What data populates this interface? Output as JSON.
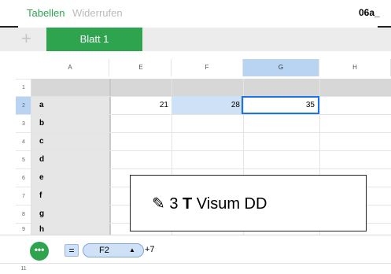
{
  "toolbar": {
    "back_label": "Tabellen",
    "undo_label": "Widerrufen",
    "document_title": "06a_"
  },
  "tabs": {
    "add_label": "+",
    "sheets": [
      {
        "label": "Blatt 1",
        "active": true
      }
    ]
  },
  "columns": [
    {
      "label": "A",
      "selected": false
    },
    {
      "label": "E",
      "selected": false
    },
    {
      "label": "F",
      "selected": false
    },
    {
      "label": "G",
      "selected": true
    },
    {
      "label": "H",
      "selected": false
    }
  ],
  "rows": [
    {
      "number": "1",
      "a": ""
    },
    {
      "number": "2",
      "a": "a"
    },
    {
      "number": "3",
      "a": "b"
    },
    {
      "number": "4",
      "a": "c"
    },
    {
      "number": "5",
      "a": "d"
    },
    {
      "number": "6",
      "a": "e"
    },
    {
      "number": "7",
      "a": "f"
    },
    {
      "number": "8",
      "a": "g"
    },
    {
      "number": "9",
      "a": "h"
    },
    {
      "number": "11",
      "a": ""
    }
  ],
  "cells": {
    "E2": "21",
    "F2": "28",
    "G2": "35"
  },
  "overlay": {
    "icon": "pencil-icon",
    "prefix": "✎ 3 ",
    "bold": "T",
    "suffix": " Visum DD"
  },
  "formula": {
    "menu_label": "•••",
    "equals": "=",
    "token_label": "F2",
    "token_arrow": "▲",
    "rest": "+7"
  },
  "colors": {
    "accent": "#2ea44f",
    "selection": "#1a73e8",
    "reference_fill": "#cfe1f6"
  }
}
